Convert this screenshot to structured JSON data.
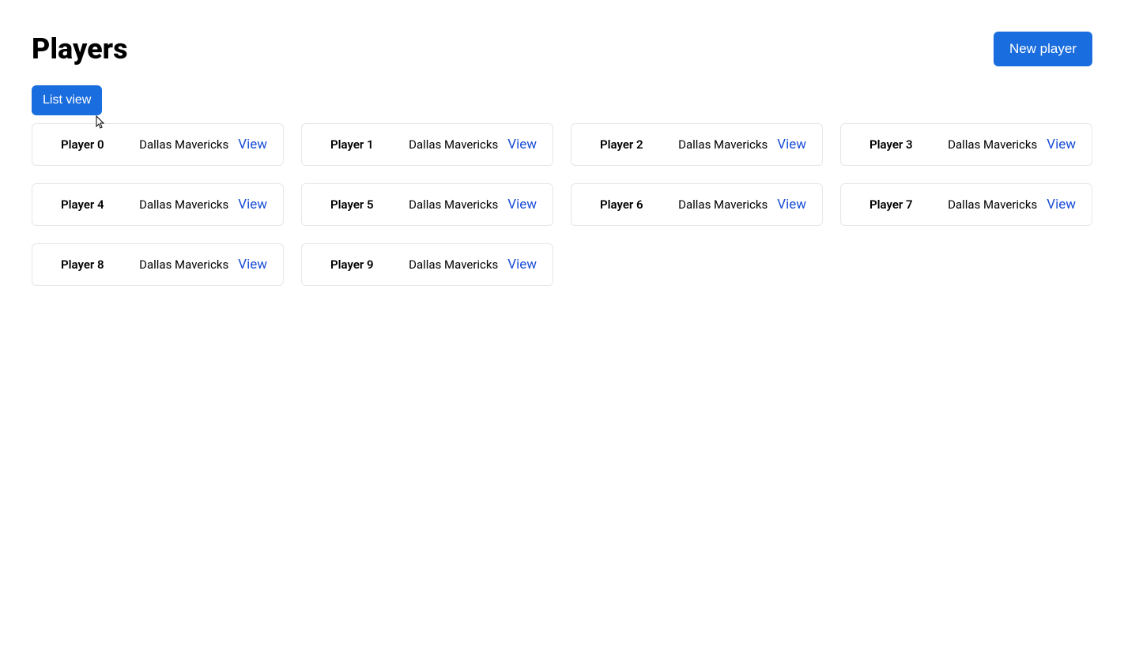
{
  "header": {
    "title": "Players",
    "new_button_label": "New player"
  },
  "toolbar": {
    "toggle_label": "List view"
  },
  "view_link_label": "View",
  "players": [
    {
      "name": "Player 0",
      "team": "Dallas Mavericks"
    },
    {
      "name": "Player 1",
      "team": "Dallas Mavericks"
    },
    {
      "name": "Player 2",
      "team": "Dallas Mavericks"
    },
    {
      "name": "Player 3",
      "team": "Dallas Mavericks"
    },
    {
      "name": "Player 4",
      "team": "Dallas Mavericks"
    },
    {
      "name": "Player 5",
      "team": "Dallas Mavericks"
    },
    {
      "name": "Player 6",
      "team": "Dallas Mavericks"
    },
    {
      "name": "Player 7",
      "team": "Dallas Mavericks"
    },
    {
      "name": "Player 8",
      "team": "Dallas Mavericks"
    },
    {
      "name": "Player 9",
      "team": "Dallas Mavericks"
    }
  ]
}
